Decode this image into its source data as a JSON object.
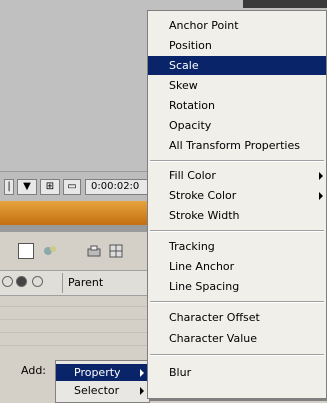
{
  "timeline": {
    "timecode": "0:00:02:0",
    "btn_a": "▼",
    "btn_b": "⊞"
  },
  "layer_panel": {
    "parent_label": "Parent"
  },
  "add_row": {
    "label": "Add:",
    "submenu": [
      {
        "label": "Property",
        "highlighted": true
      },
      {
        "label": "Selector",
        "highlighted": false
      }
    ]
  },
  "menu": {
    "group1": [
      "Anchor Point",
      "Position",
      "Scale",
      "Skew",
      "Rotation",
      "Opacity",
      "All Transform Properties"
    ],
    "highlighted": "Scale",
    "group2": [
      "Fill Color",
      "Stroke Color",
      "Stroke Width"
    ],
    "group3": [
      "Tracking",
      "Line Anchor",
      "Line Spacing"
    ],
    "group4": [
      "Character Offset",
      "Character Value"
    ],
    "group5": [
      "Blur"
    ]
  },
  "colors": {
    "highlight": "#0a246a",
    "menu_bg": "#f1efea",
    "tab_orange": "#e7a33e"
  }
}
